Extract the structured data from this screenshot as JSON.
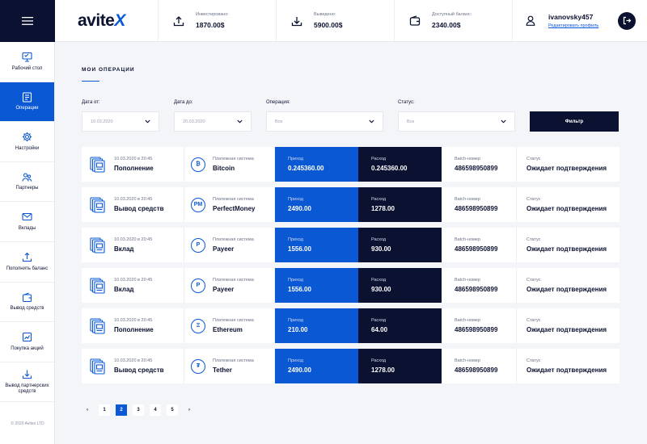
{
  "sidebar": {
    "items": [
      {
        "label": "Рабочий стол",
        "icon": "desktop-icon",
        "active": false
      },
      {
        "label": "Операции",
        "icon": "list-icon",
        "active": true
      },
      {
        "label": "Настройки",
        "icon": "gear-icon",
        "active": false
      },
      {
        "label": "Партнеры",
        "icon": "partners-icon",
        "active": false
      },
      {
        "label": "Вклады",
        "icon": "mail-icon",
        "active": false
      },
      {
        "label": "Пополнить баланс",
        "icon": "upload-icon",
        "active": false
      },
      {
        "label": "Вывод средств",
        "icon": "wallet-icon",
        "active": false
      },
      {
        "label": "Покупка акций",
        "icon": "stock-icon",
        "active": false
      },
      {
        "label": "Вывод партнерских средств",
        "icon": "download-icon",
        "active": false
      }
    ],
    "copyright": "© 2020 Avitex LTD"
  },
  "header": {
    "logo_main": "avite",
    "logo_accent": "X",
    "stats": [
      {
        "label": "Инвестировано:",
        "value": "1870.00$",
        "icon": "upload-icon"
      },
      {
        "label": "Выведено:",
        "value": "5900.00$",
        "icon": "download-icon"
      },
      {
        "label": "Доступный баланс:",
        "value": "2340.00$",
        "icon": "wallet-icon"
      }
    ],
    "username": "ivanovsky457",
    "edit_profile": "Редактировать профиль"
  },
  "page": {
    "title": "МОИ ОПЕРАЦИИ"
  },
  "filters": {
    "date_from_label": "Дата от:",
    "date_from_value": "10.03.2020",
    "date_to_label": "Дата до:",
    "date_to_value": "20.03.2020",
    "operation_label": "Операция:",
    "operation_value": "Все",
    "status_label": "Статус:",
    "status_value": "Все",
    "button": "Фильтр"
  },
  "columns": {
    "payment_system": "Платежная система",
    "income": "Приход",
    "expense": "Расход",
    "batch": "Batch-номер",
    "status": "Статус"
  },
  "rows": [
    {
      "date": "10.03.2020 в 20:45",
      "type": "Пополнение",
      "system": "Bitcoin",
      "sys_glyph": "₿",
      "income": "0.245360.00",
      "expense": "0.245360.00",
      "batch": "486598950899",
      "status": "Ожидает подтверждения"
    },
    {
      "date": "10.03.2020 в 20:45",
      "type": "Вывод средств",
      "system": "PerfectMoney",
      "sys_glyph": "PM",
      "income": "2490.00",
      "expense": "1278.00",
      "batch": "486598950899",
      "status": "Ожидает подтверждения"
    },
    {
      "date": "10.03.2020 в 20:45",
      "type": "Вклад",
      "system": "Payeer",
      "sys_glyph": "P",
      "income": "1556.00",
      "expense": "930.00",
      "batch": "486598950899",
      "status": "Ожидает подтверждения"
    },
    {
      "date": "10.03.2020 в 20:45",
      "type": "Вклад",
      "system": "Payeer",
      "sys_glyph": "P",
      "income": "1556.00",
      "expense": "930.00",
      "batch": "486598950899",
      "status": "Ожидает подтверждения"
    },
    {
      "date": "10.03.2020 в 20:45",
      "type": "Пополнение",
      "system": "Ethereum",
      "sys_glyph": "Ξ",
      "income": "210.00",
      "expense": "64.00",
      "batch": "486598950899",
      "status": "Ожидает подтверждения"
    },
    {
      "date": "10.03.2020 в 20:45",
      "type": "Вывод средств",
      "system": "Tether",
      "sys_glyph": "₮",
      "income": "2490.00",
      "expense": "1278.00",
      "batch": "486598950899",
      "status": "Ожидает подтверждения"
    }
  ],
  "pagination": {
    "prev": "‹",
    "next": "›",
    "pages": [
      "1",
      "2",
      "3",
      "4",
      "5"
    ],
    "current": "2"
  },
  "colors": {
    "accent": "#0a58d3",
    "dark": "#0b1130"
  }
}
